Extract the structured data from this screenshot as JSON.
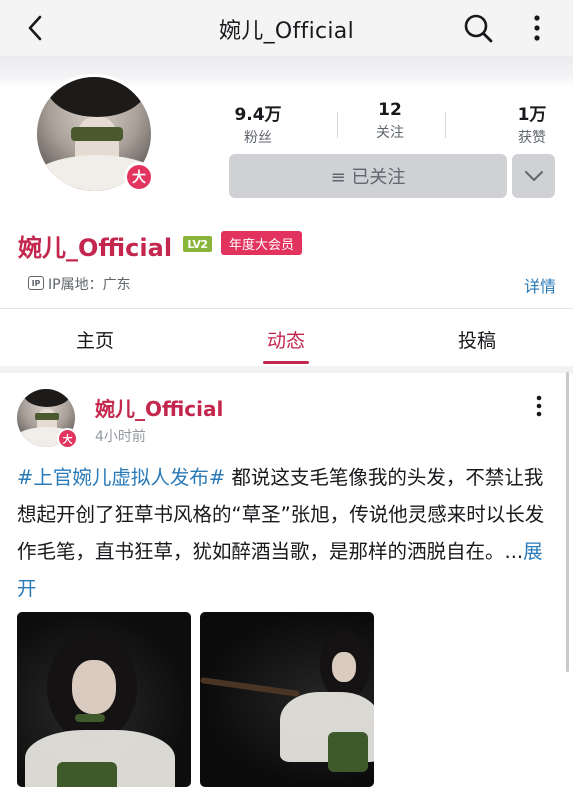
{
  "header": {
    "title": "婉儿_Official",
    "back_icon": "chevron-left-icon",
    "search_icon": "search-icon",
    "more_icon": "vertical-dots-icon"
  },
  "profile": {
    "avatar_badge": "大",
    "stats": [
      {
        "value": "9.4万",
        "label": "粉丝"
      },
      {
        "value": "12",
        "label": "关注"
      },
      {
        "value": "1万",
        "label": "获赞"
      }
    ],
    "follow_label": "≡ 已关注",
    "username": "婉儿_Official",
    "level": "LV2",
    "vip_label": "年度大会员",
    "ip_label": "IP属地：广东",
    "detail_link": "详情",
    "colors": {
      "accent": "#c3274e",
      "link": "#2a7ab8",
      "vip": "#e2335e",
      "level": "#89b63a"
    }
  },
  "tabs": [
    {
      "label": "主页",
      "active": false
    },
    {
      "label": "动态",
      "active": true
    },
    {
      "label": "投稿",
      "active": false
    }
  ],
  "post": {
    "author": "婉儿_Official",
    "badge": "大",
    "time": "4小时前",
    "hashtag": "#上官婉儿虚拟人发布#",
    "body": " 都说这支毛笔像我的头发，不禁让我想起开创了狂草书风格的“草圣”张旭，传说他灵感来时以长发作毛笔，直书狂草，犹如醉酒当歌，是那样的洒脱自在。...",
    "expand_label": "展开"
  }
}
